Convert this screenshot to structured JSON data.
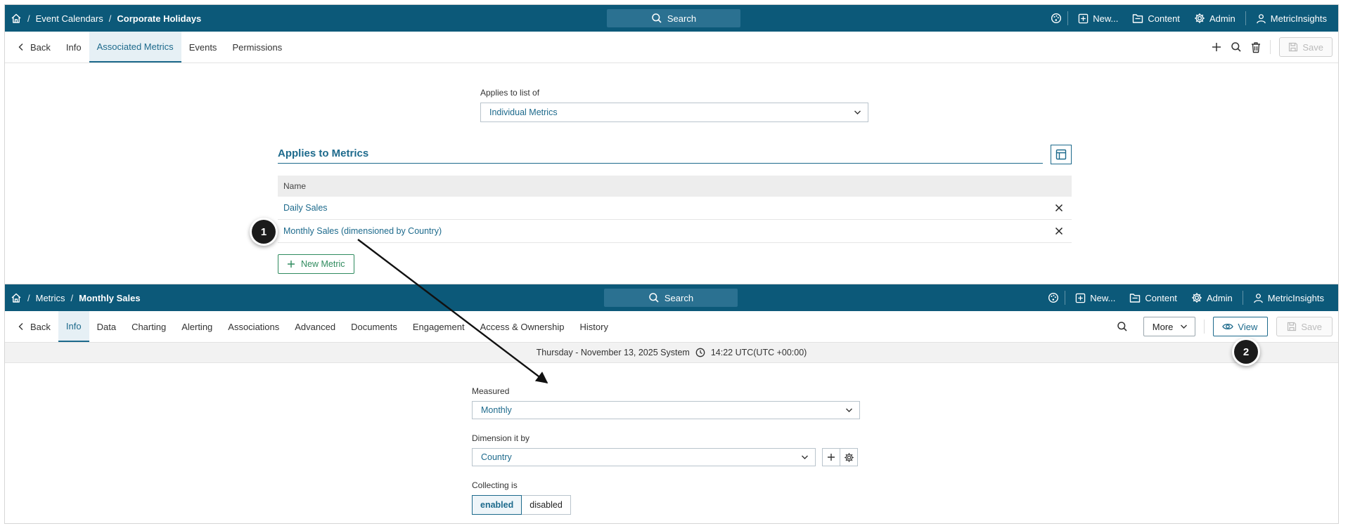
{
  "panel1": {
    "breadcrumb": {
      "item1": "Event Calendars",
      "sep": "/",
      "current": "Corporate Holidays"
    },
    "search_label": "Search",
    "top_menu": {
      "new": "New...",
      "content": "Content",
      "admin": "Admin",
      "user": "MetricInsights"
    },
    "tabs": {
      "back": "Back",
      "info": "Info",
      "associated": "Associated Metrics",
      "events": "Events",
      "permissions": "Permissions"
    },
    "save_label": "Save",
    "applies_list_label": "Applies to list of",
    "applies_list_value": "Individual Metrics",
    "section_title": "Applies to Metrics",
    "grid_header": "Name",
    "rows": [
      "Daily Sales",
      "Monthly Sales (dimensioned by Country)"
    ],
    "new_metric_label": "New Metric"
  },
  "panel2": {
    "breadcrumb": {
      "item1": "Metrics",
      "sep": "/",
      "current": "Monthly Sales"
    },
    "search_label": "Search",
    "top_menu": {
      "new": "New...",
      "content": "Content",
      "admin": "Admin",
      "user": "MetricInsights"
    },
    "tabs": {
      "back": "Back",
      "info": "Info",
      "data": "Data",
      "charting": "Charting",
      "alerting": "Alerting",
      "associations": "Associations",
      "advanced": "Advanced",
      "documents": "Documents",
      "engagement": "Engagement",
      "access": "Access & Ownership",
      "history": "History"
    },
    "more_label": "More",
    "view_label": "View",
    "save_label": "Save",
    "date_text": "Thursday - November 13, 2025 System",
    "time_text": "14:22 UTC(UTC +00:00)",
    "measured_label": "Measured",
    "measured_value": "Monthly",
    "dimension_label": "Dimension it by",
    "dimension_value": "Country",
    "collecting_label": "Collecting is",
    "enabled_label": "enabled",
    "disabled_label": "disabled"
  },
  "callouts": {
    "one": "1",
    "two": "2"
  },
  "colors": {
    "header_bg": "#0c5979",
    "accent": "#1d6a8c",
    "new_metric_green": "#2f8b5e",
    "callout_bg": "#1b1b1b"
  },
  "icons": [
    "home-icon",
    "search-icon",
    "palette-icon",
    "plus-square-icon",
    "folder-icon",
    "gear-icon",
    "user-icon",
    "chevron-left-icon",
    "plus-icon",
    "trash-icon",
    "floppy-icon",
    "chevron-down-icon",
    "grid-settings-icon",
    "close-icon",
    "clock-icon",
    "eye-icon"
  ]
}
